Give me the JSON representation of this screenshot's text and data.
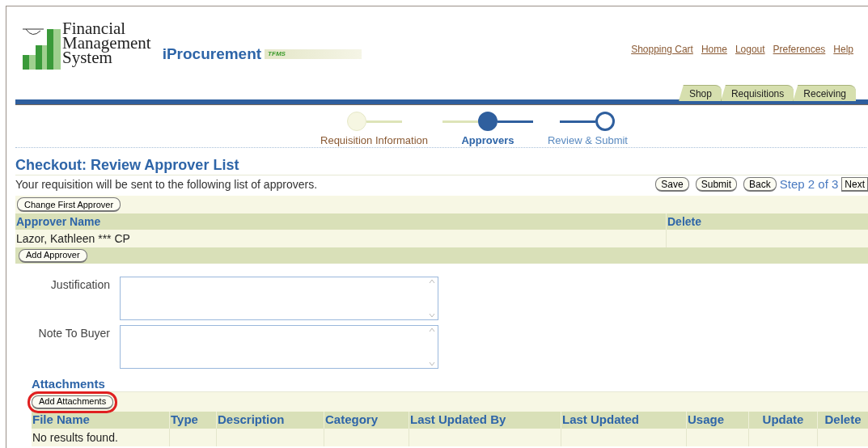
{
  "header": {
    "logo_lines": [
      "Financial",
      "Management",
      "System"
    ],
    "app_title": "iProcurement",
    "app_badge": "TFMS",
    "global_links": [
      "Shopping Cart",
      "Home",
      "Logout",
      "Preferences",
      "Help"
    ],
    "tabs": [
      {
        "label": "Shop",
        "selected": false
      },
      {
        "label": "Requisitions",
        "selected": false
      },
      {
        "label": "Receiving",
        "selected": false
      }
    ]
  },
  "train": [
    {
      "label": "Requisition Information",
      "visited": true,
      "selected": false
    },
    {
      "label": "Approvers",
      "visited": false,
      "selected": true
    },
    {
      "label": "Review & Submit",
      "visited": false,
      "selected": false
    }
  ],
  "page": {
    "title": "Checkout: Review Approver List",
    "instruction": "Your requisition will be sent to the following list of approvers.",
    "buttons": [
      "Save",
      "Submit",
      "Back"
    ],
    "step_text": "Step 2 of 3",
    "next_button": "Next"
  },
  "approvers": {
    "toolbar_button": "Change First Approver",
    "columns": [
      "Approver Name",
      "Delete"
    ],
    "rows": [
      [
        "Lazor, Kathleen *** CP",
        ""
      ]
    ],
    "footer_button": "Add Approver"
  },
  "fields": [
    {
      "label": "Justification"
    },
    {
      "label": "Note To Buyer"
    }
  ],
  "attachments": {
    "title": "Attachments",
    "button": "Add Attachments",
    "button_highlighted": true,
    "columns": [
      "File Name",
      "Type",
      "Description",
      "Category",
      "Last Updated By",
      "Last Updated",
      "Usage",
      "Update",
      "Delete"
    ],
    "empty_text": "No results found."
  }
}
